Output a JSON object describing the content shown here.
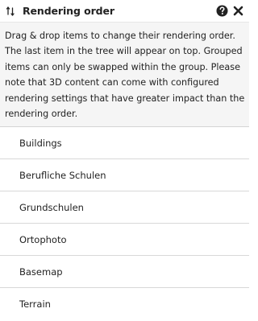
{
  "header": {
    "title": "Rendering order",
    "sort_icon": "sort-arrows-icon",
    "help_icon": "help-icon",
    "close_icon": "close-icon"
  },
  "info": {
    "text": "Drag & drop items to change their rendering order. The last item in the tree will appear on top. Grouped items can only be swapped within the group. Please note that 3D content can come with configured rendering settings that have greater impact than the rendering order."
  },
  "items": [
    {
      "label": "Buildings"
    },
    {
      "label": "Berufliche Schulen"
    },
    {
      "label": "Grundschulen"
    },
    {
      "label": "Ortophoto"
    },
    {
      "label": "Basemap"
    },
    {
      "label": "Terrain"
    }
  ],
  "colors": {
    "info_bg": "#f5f5f5",
    "border": "#d8d8d8",
    "text": "#222222"
  }
}
